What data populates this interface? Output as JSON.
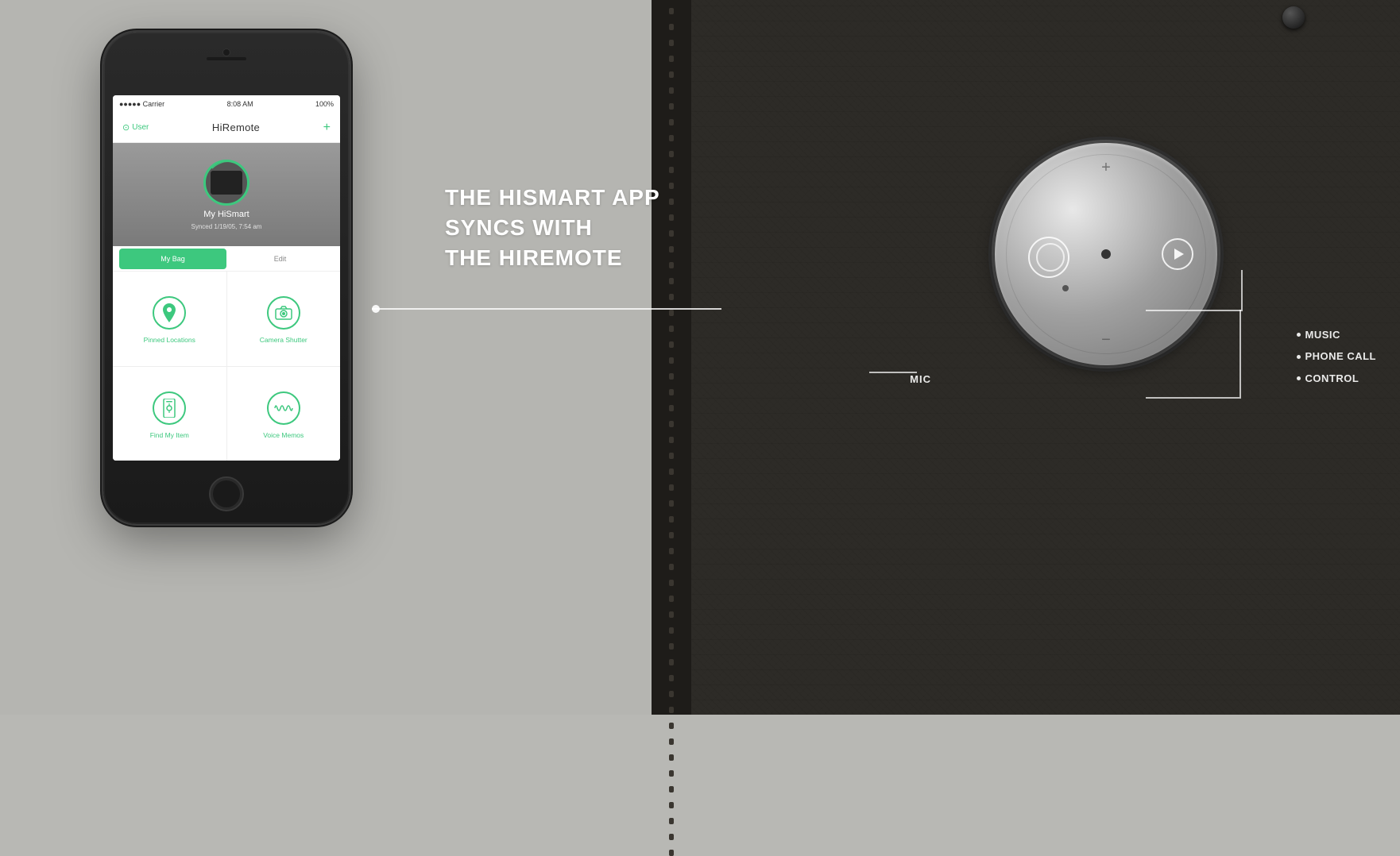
{
  "background": {
    "left_color": "#b5b5b1",
    "right_color": "#2d2b27"
  },
  "phone": {
    "status_bar": {
      "signal": "●●●●● Carrier",
      "wifi": "▾",
      "time": "8:08 AM",
      "battery": "100%"
    },
    "nav": {
      "user_label": "User",
      "title": "HiRemote",
      "add_icon": "+"
    },
    "profile": {
      "name": "My HiSmart",
      "sync_text": "Synced 1/19/05, 7:54 am"
    },
    "tabs": {
      "active": "My Bag",
      "inactive": "Edit"
    },
    "apps": [
      {
        "icon": "📍",
        "label": "Pinned Locations"
      },
      {
        "icon": "📷",
        "label": "Camera Shutter"
      },
      {
        "icon": "📱",
        "label": "Find My Item"
      },
      {
        "icon": "🎵",
        "label": "Voice Memos"
      }
    ]
  },
  "headline": {
    "line1": "THE HISMART APP",
    "line2": "SYNCS WITH",
    "line3": "THE HIREMOTE"
  },
  "annotations": {
    "mic_label": "MIC",
    "features": [
      "MUSIC",
      "PHONE CALL",
      "CONTROL"
    ]
  }
}
